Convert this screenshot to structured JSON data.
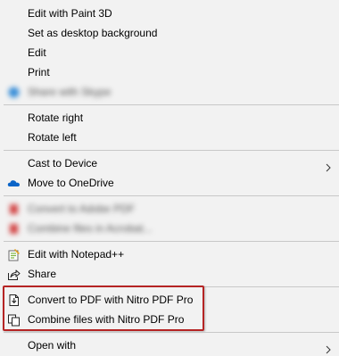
{
  "menu": {
    "items": [
      {
        "label": "Edit with Paint 3D"
      },
      {
        "label": "Set as desktop background"
      },
      {
        "label": "Edit"
      },
      {
        "label": "Print"
      },
      {
        "label": "Share with Skype"
      },
      {
        "label": "Rotate right"
      },
      {
        "label": "Rotate left"
      },
      {
        "label": "Cast to Device"
      },
      {
        "label": "Move to OneDrive"
      },
      {
        "label": "Convert to Adobe PDF"
      },
      {
        "label": "Combine files in Acrobat..."
      },
      {
        "label": "Edit with Notepad++"
      },
      {
        "label": "Share"
      },
      {
        "label": "Convert to PDF with Nitro PDF Pro"
      },
      {
        "label": "Combine files with Nitro PDF Pro"
      },
      {
        "label": "Open with"
      }
    ]
  },
  "colors": {
    "menu_bg": "#f2f2f2",
    "separator": "#c8c8c8",
    "highlight_border": "#b52424",
    "onedrive_blue": "#0a64c8",
    "notepad_green": "#7cb342"
  },
  "icons": {
    "skype": "skype-icon",
    "onedrive": "onedrive-cloud-icon",
    "adobe_convert": "adobe-pdf-icon",
    "adobe_combine": "adobe-combine-icon",
    "notepad": "notepad-plus-plus-icon",
    "share": "share-icon",
    "nitro_convert": "nitro-convert-icon",
    "nitro_combine": "nitro-combine-icon",
    "submenu_arrow": "chevron-right-icon"
  }
}
